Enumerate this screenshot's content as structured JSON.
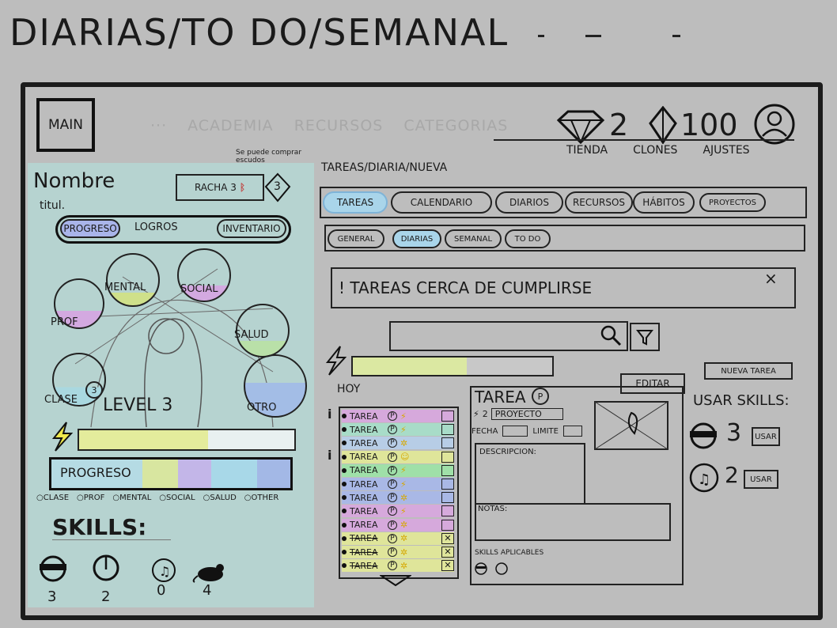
{
  "page_title": "DIARIAS/TO DO/SEMANAL",
  "topbar": {
    "main_label": "MAIN",
    "ghost_nav": [
      "···",
      "ACADEMIA",
      "RECURSOS",
      "CATEGORIAS"
    ],
    "gems": "2",
    "crystals": "100",
    "links": [
      "TIENDA",
      "CLONES",
      "AJUSTES"
    ]
  },
  "profile": {
    "name": "Nombre",
    "title": "titul.",
    "streak_label": "RACHA 3",
    "rank_note": "Se puede comprar escudos",
    "rank_value": "3",
    "tabs": [
      "PROGRESO",
      "LOGROS",
      "INVENTARIO"
    ],
    "stats": [
      {
        "key": "mental",
        "label": "MENTAL",
        "fill": 0.25,
        "color": "#cfe08a"
      },
      {
        "key": "social",
        "label": "SOCIAL",
        "fill": 0.3,
        "color": "#d3a9e0"
      },
      {
        "key": "prof",
        "label": "PROF",
        "fill": 0.35,
        "color": "#d3a9e0"
      },
      {
        "key": "salud",
        "label": "SALUD",
        "fill": 0.3,
        "color": "#b9e0a8"
      },
      {
        "key": "clase",
        "label": "CLASE",
        "fill": 0.35,
        "color": "#a9d8e0"
      },
      {
        "key": "otro",
        "label": "OTRO",
        "fill": 0.55,
        "color": "#a3bde6"
      }
    ],
    "clase_badge": "3",
    "level_label": "LEVEL 3",
    "energy_fill": 0.6,
    "progress_label": "PROGRESO",
    "legend": [
      "CLASE",
      "PROF",
      "MENTAL",
      "SOCIAL",
      "SALUD",
      "OTHER"
    ],
    "skills_title": "SKILLS:",
    "skills": [
      {
        "icon": "ninja-mask-icon",
        "count": "3"
      },
      {
        "icon": "clock-icon",
        "count": "2"
      },
      {
        "icon": "music-note-icon",
        "count": "0"
      },
      {
        "icon": "rat-icon",
        "count": "4"
      }
    ]
  },
  "breadcrumb": "TAREAS/DIARIA/NUEVA",
  "main_tabs": [
    "TAREAS",
    "CALENDARIO",
    "DIARIOS",
    "RECURSOS",
    "HÁBITOS",
    "PROYECTOS"
  ],
  "sub_tabs": [
    "GENERAL",
    "DIARIAS",
    "SEMANAL",
    "TO DO"
  ],
  "alert": {
    "text": "! TAREAS CERCA DE CUMPLIRSE",
    "close": "×"
  },
  "search": {
    "placeholder": ""
  },
  "daily_progress": 0.57,
  "today_label": "HOY",
  "tasks": [
    {
      "label": "TAREA",
      "color": "#d6a9dc",
      "icon": "⚡",
      "done": false
    },
    {
      "label": "TAREA",
      "color": "#a8dcc8",
      "icon": "⚡",
      "done": false
    },
    {
      "label": "TAREA",
      "color": "#b7cde6",
      "icon": "✲",
      "done": false
    },
    {
      "label": "TAREA",
      "color": "#dfe59a",
      "icon": "☺",
      "done": false
    },
    {
      "label": "TAREA",
      "color": "#9fe0a8",
      "icon": "⚡",
      "done": false
    },
    {
      "label": "TAREA",
      "color": "#a9b8e6",
      "icon": "⚡",
      "done": false
    },
    {
      "label": "TAREA",
      "color": "#a9b8e6",
      "icon": "✲",
      "done": false
    },
    {
      "label": "TAREA",
      "color": "#d6a9dc",
      "icon": "⚡",
      "done": false
    },
    {
      "label": "TAREA",
      "color": "#d6a9dc",
      "icon": "✲",
      "done": false
    },
    {
      "label": "TAREA",
      "color": "#dfe59a",
      "icon": "✲",
      "done": true
    },
    {
      "label": "TAREA",
      "color": "#dfe59a",
      "icon": "✲",
      "done": true
    },
    {
      "label": "TAREA",
      "color": "#dfe59a",
      "icon": "✲",
      "done": true
    }
  ],
  "detail": {
    "title": "TAREA",
    "badge": "P",
    "edit_label": "EDITAR",
    "project_num": "2",
    "project_label": "PROYECTO",
    "date_label": "FECHA",
    "limit_label": "LIMITE",
    "description_label": "DESCRIPCION:",
    "notes_label": "NOTAS:",
    "skills_label": "SKILLS APLICABLES"
  },
  "new_task_label": "NUEVA TAREA",
  "use_skills": {
    "title": "USAR SKILLS:",
    "items": [
      {
        "icon": "ninja-mask-icon",
        "count": "3",
        "button": "USAR"
      },
      {
        "icon": "music-note-icon",
        "count": "2",
        "button": "USAR"
      }
    ]
  }
}
